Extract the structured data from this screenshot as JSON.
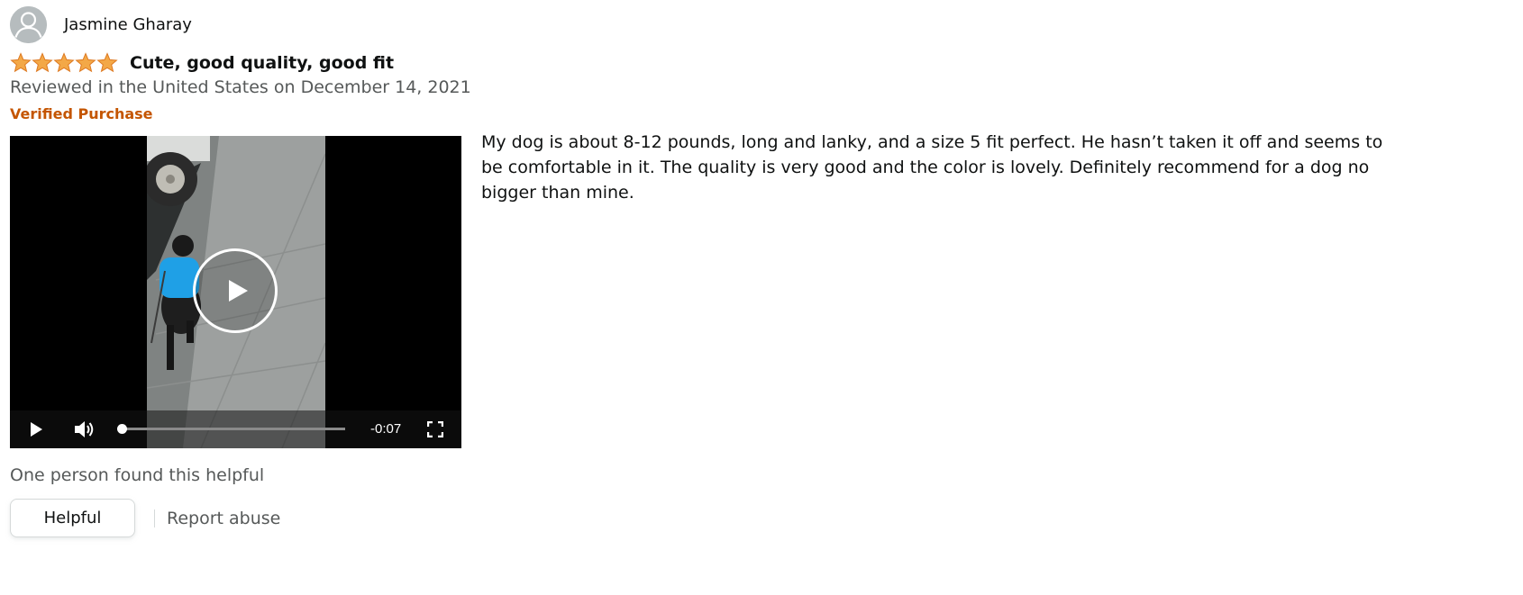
{
  "reviewer": {
    "name": "Jasmine Gharay",
    "avatar_icon": "person-silhouette-icon"
  },
  "rating": {
    "stars": 5,
    "max": 5,
    "star_color": "#f3a847",
    "title": "Cute, good quality, good fit"
  },
  "review_date": "Reviewed in the United States on December 14, 2021",
  "verified_label": "Verified Purchase",
  "video": {
    "time_remaining": "-0:07",
    "progress": 0.0,
    "play_icon": "play-icon",
    "volume_icon": "volume-icon",
    "fullscreen_icon": "fullscreen-icon",
    "overlay_icon": "play-circle-icon"
  },
  "body": " My dog is about 8-12 pounds, long and lanky, and a size 5 fit perfect. He hasn’t taken it off and seems to be comfortable in it. The quality is very good and the color is lovely. Definitely recommend for a dog no bigger than mine.",
  "helpful_count_text": "One person found this helpful",
  "actions": {
    "helpful_label": "Helpful",
    "report_label": "Report abuse"
  },
  "colors": {
    "verified": "#c45500",
    "secondary_text": "#565959",
    "primary_text": "#0f1111"
  }
}
